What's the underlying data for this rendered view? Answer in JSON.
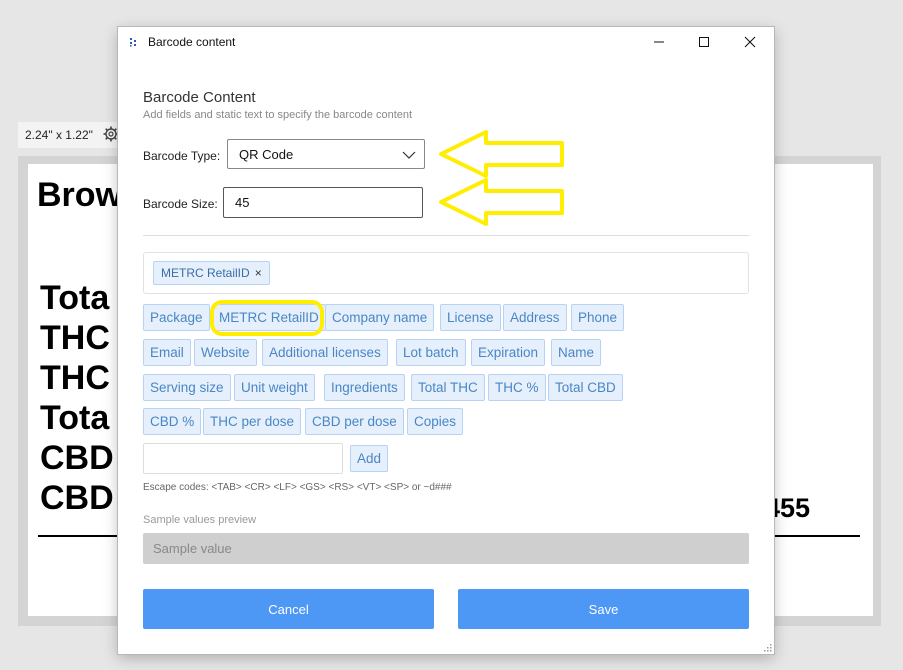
{
  "background": {
    "label_size": "2.24\" x 1.22\"",
    "settings_icon": "gear-icon",
    "label_lines": [
      "Brow",
      "Tota",
      "THC",
      "THC",
      "Tota",
      "CBD",
      "CBD"
    ],
    "label_number": "455"
  },
  "dialog": {
    "title": "Barcode content",
    "heading": "Barcode Content",
    "subheading": "Add fields and static text to specify the barcode content",
    "barcode_type_label": "Barcode Type:",
    "barcode_type_value": "QR Code",
    "barcode_size_label": "Barcode Size:",
    "barcode_size_value": "45",
    "selected_tokens": [
      "METRC RetailID"
    ],
    "token_remove": "×",
    "fields": [
      "Package",
      "METRC RetailID",
      "Company name",
      "License",
      "Address",
      "Phone",
      "Email",
      "Website",
      "Additional licenses",
      "Lot batch",
      "Expiration",
      "Name",
      "Serving size",
      "Unit weight",
      "Ingredients",
      "Total THC",
      "THC %",
      "Total CBD",
      "CBD %",
      "THC per dose",
      "CBD per dose",
      "Copies"
    ],
    "add_label": "Add",
    "escape_codes": "Escape codes: <TAB> <CR> <LF> <GS> <RS> <VT> <SP> or ~d###",
    "preview_label": "Sample values preview",
    "preview_value": "Sample value",
    "cancel_label": "Cancel",
    "save_label": "Save"
  },
  "annotation_color": "#ffee00",
  "accent": "#4d97f5"
}
